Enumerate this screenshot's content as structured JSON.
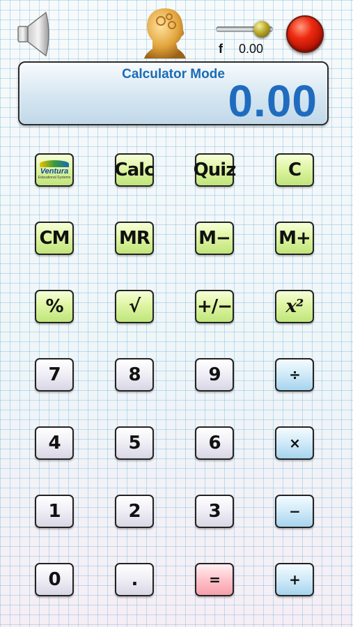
{
  "toolbar": {
    "speaker_icon": "speaker-icon",
    "head_icon": "head-gears-icon",
    "frequency_label": "f",
    "frequency_value": "0.00",
    "record_icon": "red-record-button"
  },
  "display": {
    "mode_label": "Calculator Mode",
    "value": "0.00"
  },
  "keys": {
    "logo": {
      "text": "Ventura",
      "sub": "Educational Systems"
    },
    "calc": "Calc",
    "quiz": "Quiz",
    "clear": "C",
    "cm": "CM",
    "mr": "MR",
    "m_minus": "M−",
    "m_plus": "M+",
    "percent": "%",
    "sqrt": "√",
    "plus_minus": "+/−",
    "square": "x²",
    "seven": "7",
    "eight": "8",
    "nine": "9",
    "divide": "÷",
    "four": "4",
    "five": "5",
    "six": "6",
    "multiply": "×",
    "one": "1",
    "two": "2",
    "three": "3",
    "minus": "−",
    "zero": "0",
    "dot": ".",
    "equals": "=",
    "plus": "+"
  },
  "colors": {
    "accent_blue": "#1f6cbf",
    "green_key": "#dff5a3",
    "grey_key": "#efeef6",
    "blue_key": "#cfeaf8",
    "equals_key": "#ffc2c9"
  }
}
